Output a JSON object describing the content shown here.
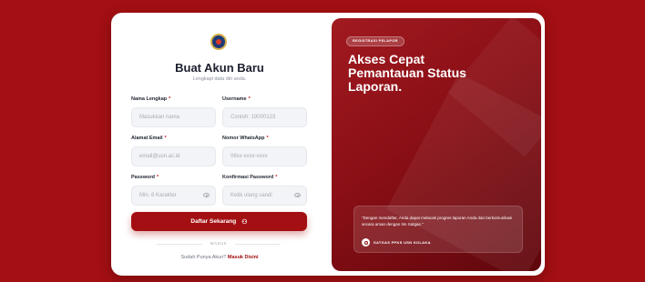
{
  "form": {
    "title": "Buat Akun Baru",
    "subtitle": "Lengkapi data diri anda.",
    "fields": [
      {
        "label": "Nama Lengkap",
        "required": "*",
        "placeholder": "Masukkan nama"
      },
      {
        "label": "Username",
        "required": "*",
        "placeholder": "Contoh: 19000123"
      },
      {
        "label": "Alamat Email",
        "required": "*",
        "placeholder": "email@usn.ac.id"
      },
      {
        "label": "Nomor WhatsApp",
        "required": "*",
        "placeholder": "08xx-xxxx-xxxx"
      },
      {
        "label": "Password",
        "required": "*",
        "placeholder": "Min. 8 Karakter"
      },
      {
        "label": "Konfirmasi Password",
        "required": "*",
        "placeholder": "Ketik ulang sandi"
      }
    ],
    "submit_label": "Daftar Sekarang",
    "divider_text": "MASUK",
    "login_prompt": "Sudah Punya Akun?",
    "login_link": "Masuk Disini"
  },
  "hero": {
    "badge": "REGISTRASI PELAPOR",
    "title": "Akses Cepat Pemantauan Status Laporan.",
    "quote": "\"Dengan mendaftar, Anda dapat melacak progres laporan Anda dan berkomunikasi secara aman dengan tim Satgas.\"",
    "org_name": "SATGAS PPKS USN KOLAKA"
  },
  "colors": {
    "brand": "#a30f12",
    "background": "#a30f12"
  },
  "icons": {
    "password_toggle": "eye-icon",
    "submit": "user-add-icon",
    "logo": "university-logo",
    "org": "shield-icon"
  }
}
